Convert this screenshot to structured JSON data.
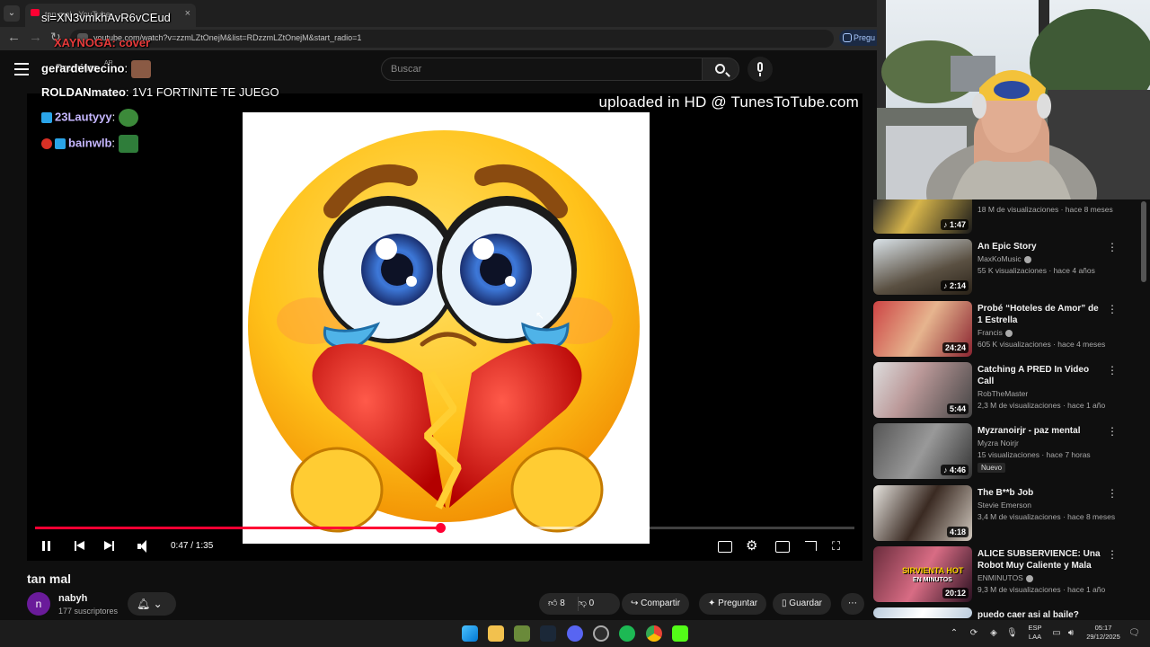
{
  "browser": {
    "tab_title": "tan mal - YouTube",
    "tab_close": "×",
    "url": "youtube.com/watch?v=zzmLZtOnejM&list=RDzzmLZtOnejM&start_radio=1",
    "pregunta_label": "Pregu"
  },
  "header": {
    "logo": "Premium",
    "premium_tag": "AR",
    "search_placeholder": "Buscar"
  },
  "chat": {
    "overlay_line_1": "si=XN3vmkhAvR6vCEud",
    "overlay_line_2": "XAYNOGA: cover",
    "messages": [
      {
        "user": "gerardelvecino",
        "text": ""
      },
      {
        "user": "ROLDANmateo",
        "text": "1V1 FORTINITE TE JUEGO"
      },
      {
        "user": "23Lautyyy",
        "text": ""
      },
      {
        "user": "bainwlb",
        "text": ""
      }
    ]
  },
  "player": {
    "watermark": "uploaded in HD @ TunesToTube.com",
    "time": "0:47 / 1:35",
    "progress": 0.494,
    "buffered": 0.67,
    "accent": "#ff0033"
  },
  "video": {
    "title": "tan mal",
    "channel": "nabyh",
    "channel_initial": "n",
    "subscribers": "177 suscriptores",
    "likes": "8",
    "dislikes": "0",
    "share": "Compartir",
    "ask": "Preguntar",
    "save": "Guardar",
    "more": "⋯"
  },
  "sidebar": {
    "top_partial": {
      "duration": "1:47",
      "meta": "18 M de visualizaciones · hace 8 meses"
    },
    "items": [
      {
        "title": "An Epic Story",
        "channel": "MaxKoMusic",
        "verified": true,
        "meta": "55 K visualizaciones · hace 4 años",
        "duration": "2:14",
        "new": ""
      },
      {
        "title": "Probé “Hoteles de Amor” de 1 Estrella",
        "channel": "Francis",
        "verified": true,
        "meta": "605 K visualizaciones · hace 4 meses",
        "duration": "24:24",
        "new": ""
      },
      {
        "title": "Catching A PRED In Video Call",
        "channel": "RobTheMaster",
        "verified": false,
        "meta": "2,3 M de visualizaciones · hace 1 año",
        "duration": "5:44",
        "new": ""
      },
      {
        "title": "Myzranoirjr - paz mental",
        "channel": "Myzra Noirjr",
        "verified": false,
        "meta": "15 visualizaciones · hace 7 horas",
        "duration": "4:46",
        "new": "Nuevo"
      },
      {
        "title": "The B**b Job",
        "channel": "Stevie Emerson",
        "verified": false,
        "meta": "3,4 M de visualizaciones · hace 8 meses",
        "duration": "4:18",
        "new": ""
      },
      {
        "title": "ALICE SUBSERVIENCE: Una Robot Muy Caliente y Mala",
        "channel": "ENMINUTOS",
        "verified": true,
        "meta": "9,3 M de visualizaciones · hace 1 año",
        "duration": "20:12",
        "new": ""
      },
      {
        "title": "puedo caer asi al baile?",
        "channel": "",
        "verified": false,
        "meta": "",
        "duration": "",
        "new": ""
      }
    ],
    "thumb_overlay_1": "SIRVIENTA HOT",
    "thumb_overlay_2": "EN MINUTOS"
  },
  "taskbar": {
    "lang_1": "ESP",
    "lang_2": "LAA",
    "time": "05:17",
    "date": "29/12/2025"
  }
}
